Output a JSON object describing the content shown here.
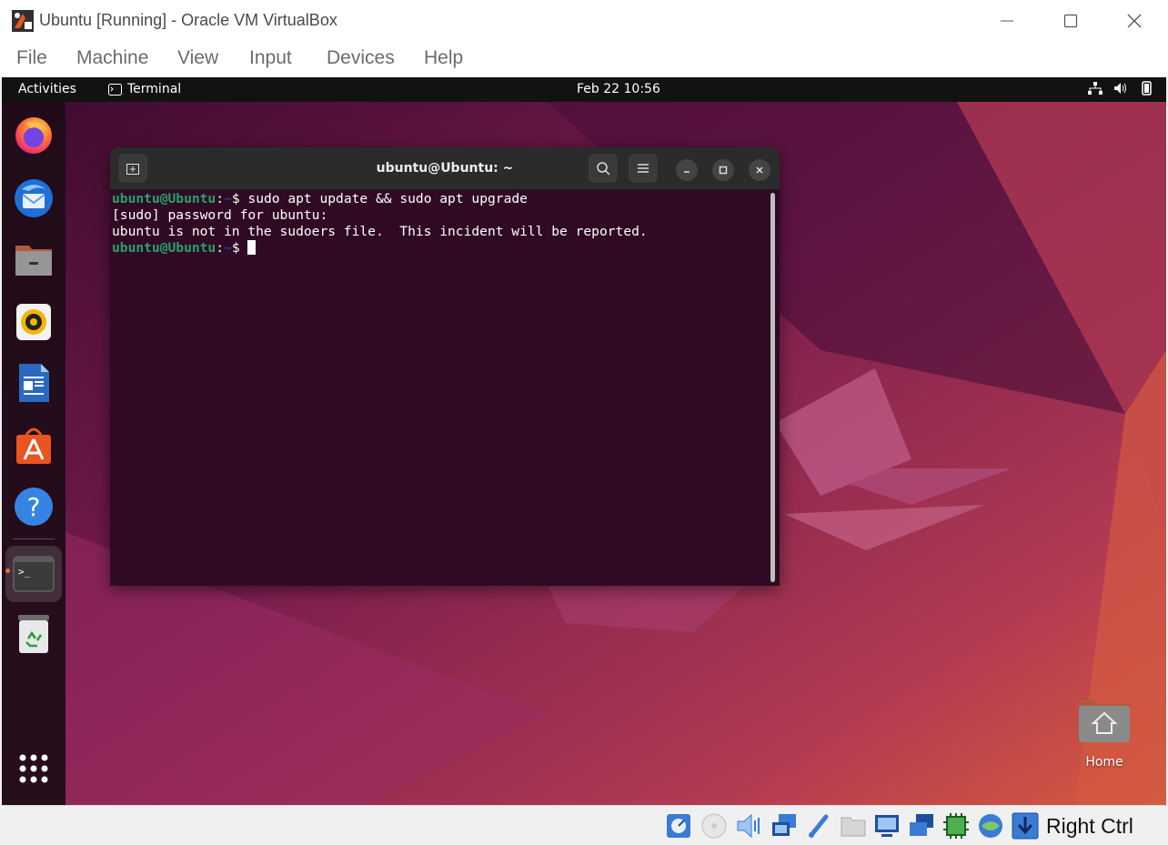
{
  "window": {
    "title": "Ubuntu [Running] - Oracle VM VirtualBox"
  },
  "menu": [
    "File",
    "Machine",
    "View",
    "Input",
    "Devices",
    "Help"
  ],
  "guest": {
    "topbar": {
      "activities": "Activities",
      "app_name": "Terminal",
      "clock": "Feb 22  10:56"
    },
    "dock_apps": [
      "firefox-icon",
      "thunderbird-icon",
      "files-icon",
      "rhythmbox-icon",
      "writer-icon",
      "software-icon",
      "help-icon",
      "terminal-icon",
      "trash-icon",
      "show-apps-icon"
    ],
    "terminal": {
      "title": "ubuntu@Ubuntu: ~",
      "prompt_user": "ubuntu@Ubuntu",
      "prompt_path": "~",
      "lines": [
        {
          "type": "prompt",
          "command": "sudo apt update && sudo apt upgrade"
        },
        {
          "type": "output",
          "text": "[sudo] password for ubuntu:"
        },
        {
          "type": "output",
          "text": "ubuntu is not in the sudoers file.  This incident will be reported."
        },
        {
          "type": "prompt",
          "command": ""
        }
      ]
    },
    "desktop": {
      "home_label": "Home"
    }
  },
  "statusbar": {
    "host_key": "Right Ctrl"
  },
  "colors": {
    "ubuntu_orange": "#e95420",
    "terminal_bg": "#300a24",
    "prompt_green": "#26a269",
    "prompt_blue": "#12488b"
  }
}
